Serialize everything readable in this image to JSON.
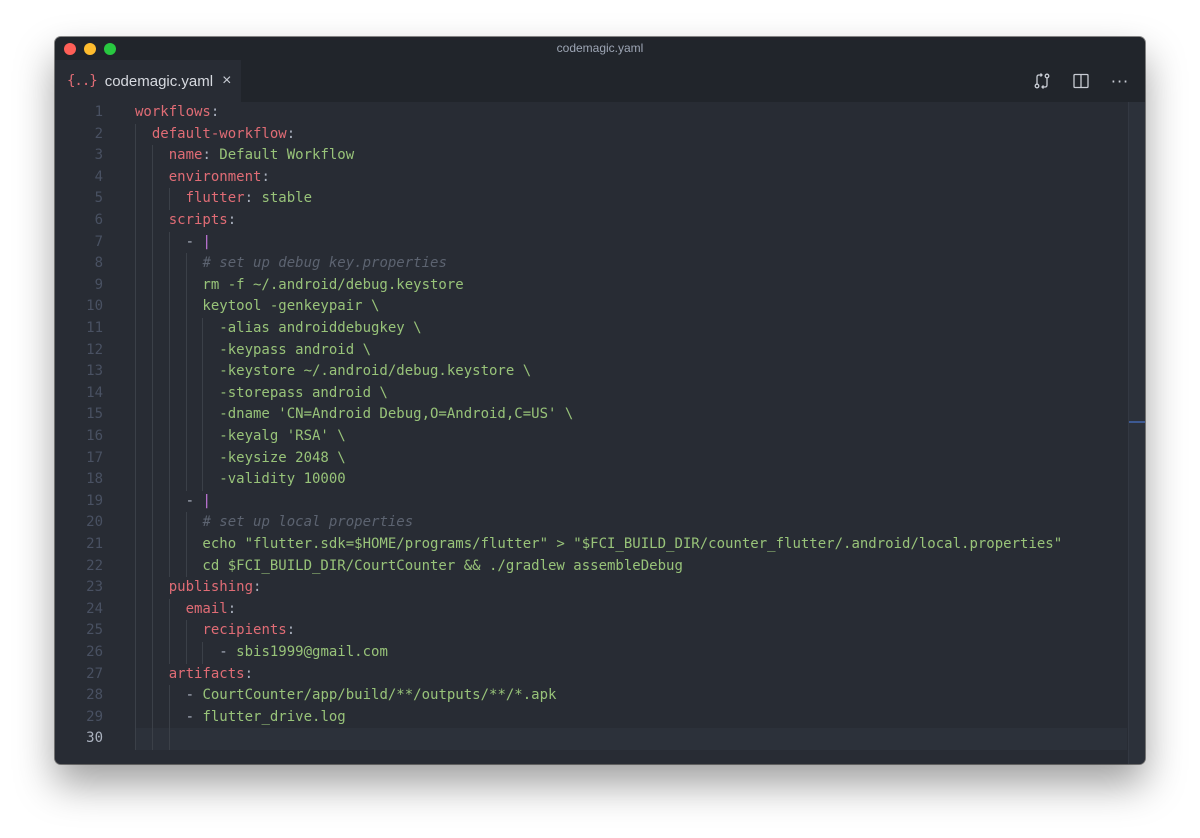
{
  "window": {
    "title": "codemagic.yaml"
  },
  "tab": {
    "icon": "yaml-file-icon",
    "label": "codemagic.yaml",
    "close_label": "×"
  },
  "toolbar": {
    "actions": [
      "compare-changes-icon",
      "split-editor-icon",
      "more-actions-icon"
    ],
    "more_label": "···"
  },
  "editor": {
    "active_line": 30,
    "lines": [
      {
        "n": "1",
        "tokens": [
          [
            "k",
            "workflows"
          ],
          [
            "p",
            ":"
          ]
        ]
      },
      {
        "n": "2",
        "tokens": [
          [
            "s",
            "  "
          ],
          [
            "k",
            "default-workflow"
          ],
          [
            "p",
            ":"
          ]
        ]
      },
      {
        "n": "3",
        "tokens": [
          [
            "s",
            "    "
          ],
          [
            "k",
            "name"
          ],
          [
            "p",
            ": "
          ],
          [
            "s",
            "Default Workflow"
          ]
        ]
      },
      {
        "n": "4",
        "tokens": [
          [
            "s",
            "    "
          ],
          [
            "k",
            "environment"
          ],
          [
            "p",
            ":"
          ]
        ]
      },
      {
        "n": "5",
        "tokens": [
          [
            "s",
            "      "
          ],
          [
            "k",
            "flutter"
          ],
          [
            "p",
            ": "
          ],
          [
            "s",
            "stable"
          ]
        ]
      },
      {
        "n": "6",
        "tokens": [
          [
            "s",
            "    "
          ],
          [
            "k",
            "scripts"
          ],
          [
            "p",
            ":"
          ]
        ]
      },
      {
        "n": "7",
        "tokens": [
          [
            "s",
            "      "
          ],
          [
            "p",
            "- "
          ],
          [
            "bar",
            "|"
          ]
        ]
      },
      {
        "n": "8",
        "tokens": [
          [
            "s",
            "        "
          ],
          [
            "c",
            "# set up debug key.properties"
          ]
        ]
      },
      {
        "n": "9",
        "tokens": [
          [
            "s",
            "        rm -f ~/.android/debug.keystore"
          ]
        ]
      },
      {
        "n": "10",
        "tokens": [
          [
            "s",
            "        keytool -genkeypair \\"
          ]
        ]
      },
      {
        "n": "11",
        "tokens": [
          [
            "s",
            "          -alias androiddebugkey \\"
          ]
        ]
      },
      {
        "n": "12",
        "tokens": [
          [
            "s",
            "          -keypass android \\"
          ]
        ]
      },
      {
        "n": "13",
        "tokens": [
          [
            "s",
            "          -keystore ~/.android/debug.keystore \\"
          ]
        ]
      },
      {
        "n": "14",
        "tokens": [
          [
            "s",
            "          -storepass android \\"
          ]
        ]
      },
      {
        "n": "15",
        "tokens": [
          [
            "s",
            "          -dname 'CN=Android Debug,O=Android,C=US' \\"
          ]
        ]
      },
      {
        "n": "16",
        "tokens": [
          [
            "s",
            "          -keyalg 'RSA' \\"
          ]
        ]
      },
      {
        "n": "17",
        "tokens": [
          [
            "s",
            "          -keysize 2048 \\"
          ]
        ]
      },
      {
        "n": "18",
        "tokens": [
          [
            "s",
            "          -validity 10000"
          ]
        ]
      },
      {
        "n": "19",
        "tokens": [
          [
            "s",
            "      "
          ],
          [
            "p",
            "- "
          ],
          [
            "bar",
            "|"
          ]
        ]
      },
      {
        "n": "20",
        "tokens": [
          [
            "s",
            "        "
          ],
          [
            "c",
            "# set up local properties"
          ]
        ]
      },
      {
        "n": "21",
        "tokens": [
          [
            "s",
            "        echo \"flutter.sdk=$HOME/programs/flutter\" > \"$FCI_BUILD_DIR/counter_flutter/.android/local.properties\""
          ]
        ]
      },
      {
        "n": "22",
        "tokens": [
          [
            "s",
            "        cd $FCI_BUILD_DIR/CourtCounter && ./gradlew assembleDebug"
          ]
        ]
      },
      {
        "n": "23",
        "tokens": [
          [
            "s",
            "    "
          ],
          [
            "k",
            "publishing"
          ],
          [
            "p",
            ":"
          ]
        ]
      },
      {
        "n": "24",
        "tokens": [
          [
            "s",
            "      "
          ],
          [
            "k",
            "email"
          ],
          [
            "p",
            ":"
          ]
        ]
      },
      {
        "n": "25",
        "tokens": [
          [
            "s",
            "        "
          ],
          [
            "k",
            "recipients"
          ],
          [
            "p",
            ":"
          ]
        ]
      },
      {
        "n": "26",
        "tokens": [
          [
            "s",
            "          "
          ],
          [
            "p",
            "- "
          ],
          [
            "s",
            "sbis1999@gmail.com"
          ]
        ]
      },
      {
        "n": "27",
        "tokens": [
          [
            "s",
            "    "
          ],
          [
            "k",
            "artifacts"
          ],
          [
            "p",
            ":"
          ]
        ]
      },
      {
        "n": "28",
        "tokens": [
          [
            "s",
            "      "
          ],
          [
            "p",
            "- "
          ],
          [
            "s",
            "CourtCounter/app/build/**/outputs/**/*.apk"
          ]
        ]
      },
      {
        "n": "29",
        "tokens": [
          [
            "s",
            "      "
          ],
          [
            "p",
            "- "
          ],
          [
            "s",
            "flutter_drive.log"
          ]
        ]
      },
      {
        "n": "30",
        "tokens": []
      }
    ]
  },
  "colors": {
    "background": "#282c34",
    "key": "#e06c75",
    "string": "#98c379",
    "comment": "#5c6370",
    "punctuation": "#abb2bf",
    "block_indicator": "#c678dd"
  }
}
